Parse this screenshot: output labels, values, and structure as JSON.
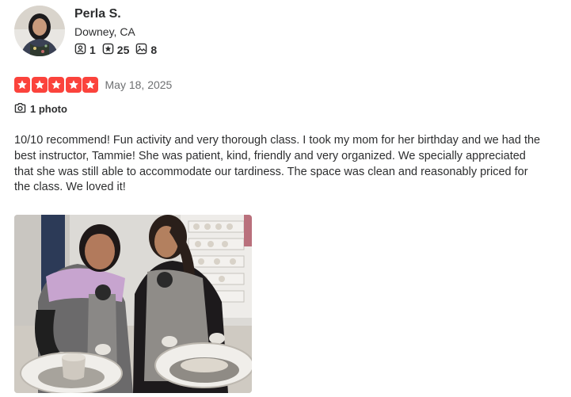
{
  "user": {
    "name": "Perla S.",
    "location": "Downey, CA",
    "stats": {
      "friends": "1",
      "reviews": "25",
      "photos": "8"
    }
  },
  "review": {
    "rating": 5,
    "max_rating": 5,
    "date": "May 18, 2025",
    "photo_count_label": "1 photo",
    "text": "10/10 recommend! Fun activity and very thorough class. I took my mom for her birthday and we had the best instructor, Tammie! She was patient, kind, friendly and very organized. We specially appreciated that she was still able to accommodate our tardiness. The space was clean and reasonably priced for the class. We loved it!"
  },
  "colors": {
    "star_red": "#fb433c",
    "text_primary": "#2d2e2f",
    "text_secondary": "#6e7072"
  },
  "icons": {
    "friends": "friends-icon",
    "reviews": "review-star-icon",
    "photos": "photo-icon",
    "camera": "camera-icon"
  }
}
